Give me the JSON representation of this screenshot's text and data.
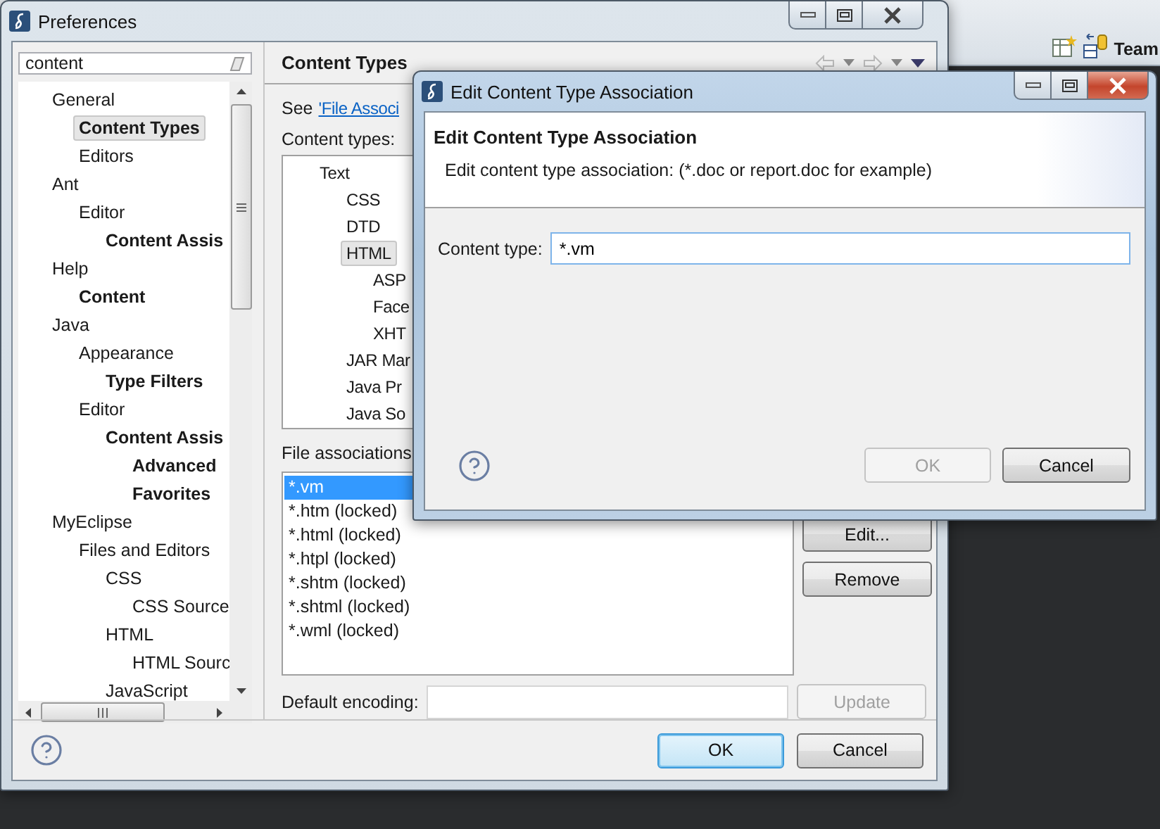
{
  "desktop": {
    "toolbar_label": "Team"
  },
  "preferences": {
    "title": "Preferences",
    "filter": "content",
    "tree": [
      {
        "label": "General",
        "selected": false,
        "matched": false,
        "children": [
          {
            "label": "Content Types",
            "selected": true,
            "matched": true
          },
          {
            "label": "Editors",
            "selected": false,
            "matched": false
          }
        ]
      },
      {
        "label": "Ant",
        "selected": false,
        "matched": false,
        "children": [
          {
            "label": "Editor",
            "selected": false,
            "matched": false,
            "children": [
              {
                "label": "Content Assis",
                "selected": false,
                "matched": true
              }
            ]
          }
        ]
      },
      {
        "label": "Help",
        "selected": false,
        "matched": false,
        "children": [
          {
            "label": "Content",
            "selected": false,
            "matched": true
          }
        ]
      },
      {
        "label": "Java",
        "selected": false,
        "matched": false,
        "children": [
          {
            "label": "Appearance",
            "selected": false,
            "matched": false,
            "children": [
              {
                "label": "Type Filters",
                "selected": false,
                "matched": true
              }
            ]
          },
          {
            "label": "Editor",
            "selected": false,
            "matched": false,
            "children": [
              {
                "label": "Content Assis",
                "selected": false,
                "matched": true,
                "children": [
                  {
                    "label": "Advanced",
                    "selected": false,
                    "matched": true
                  },
                  {
                    "label": "Favorites",
                    "selected": false,
                    "matched": true
                  }
                ]
              }
            ]
          }
        ]
      },
      {
        "label": "MyEclipse",
        "selected": false,
        "matched": false,
        "children": [
          {
            "label": "Files and Editors",
            "selected": false,
            "matched": false,
            "children": [
              {
                "label": "CSS",
                "selected": false,
                "matched": false,
                "children": [
                  {
                    "label": "CSS Source",
                    "selected": false,
                    "matched": false
                  }
                ]
              },
              {
                "label": "HTML",
                "selected": false,
                "matched": false,
                "children": [
                  {
                    "label": "HTML Sourc",
                    "selected": false,
                    "matched": false
                  }
                ]
              },
              {
                "label": "JavaScript",
                "selected": false,
                "matched": false
              }
            ]
          }
        ]
      }
    ],
    "page_title": "Content Types",
    "see_prefix": "See",
    "see_link": "'File Associ",
    "content_types_label": "Content types:",
    "content_types": [
      {
        "label": "Text",
        "selected": false,
        "children": [
          {
            "label": "CSS",
            "selected": false
          },
          {
            "label": "DTD",
            "selected": false
          },
          {
            "label": "HTML",
            "selected": true,
            "children": [
              {
                "label": "ASP",
                "selected": false
              },
              {
                "label": "Face",
                "selected": false
              },
              {
                "label": "XHT",
                "selected": false
              }
            ]
          },
          {
            "label": "JAR Mar",
            "selected": false
          },
          {
            "label": "Java Pr",
            "selected": false
          },
          {
            "label": "Java So",
            "selected": false
          }
        ]
      }
    ],
    "file_associations_label": "File associations",
    "file_associations": [
      {
        "label": "*.vm",
        "selected": true
      },
      {
        "label": "*.htm (locked)",
        "selected": false
      },
      {
        "label": "*.html (locked)",
        "selected": false
      },
      {
        "label": "*.htpl (locked)",
        "selected": false
      },
      {
        "label": "*.shtm (locked)",
        "selected": false
      },
      {
        "label": "*.shtml (locked)",
        "selected": false
      },
      {
        "label": "*.wml (locked)",
        "selected": false
      }
    ],
    "side_buttons": [
      {
        "label": "Edit...",
        "disabled": false
      },
      {
        "label": "Remove",
        "disabled": false
      }
    ],
    "default_encoding_label": "Default encoding:",
    "update_button": {
      "label": "Update",
      "disabled": true
    },
    "ok": {
      "label": "OK",
      "default": true,
      "disabled": false
    },
    "cancel": {
      "label": "Cancel",
      "default": false,
      "disabled": false
    }
  },
  "dialog": {
    "title": "Edit Content Type Association",
    "heading": "Edit Content Type Association",
    "description": "Edit content type association: (*.doc or report.doc for example)",
    "field_label": "Content type:",
    "field_value": "*.vm",
    "ok": {
      "label": "OK",
      "default": false,
      "disabled": true
    },
    "cancel": {
      "label": "Cancel",
      "default": false,
      "disabled": false
    }
  }
}
